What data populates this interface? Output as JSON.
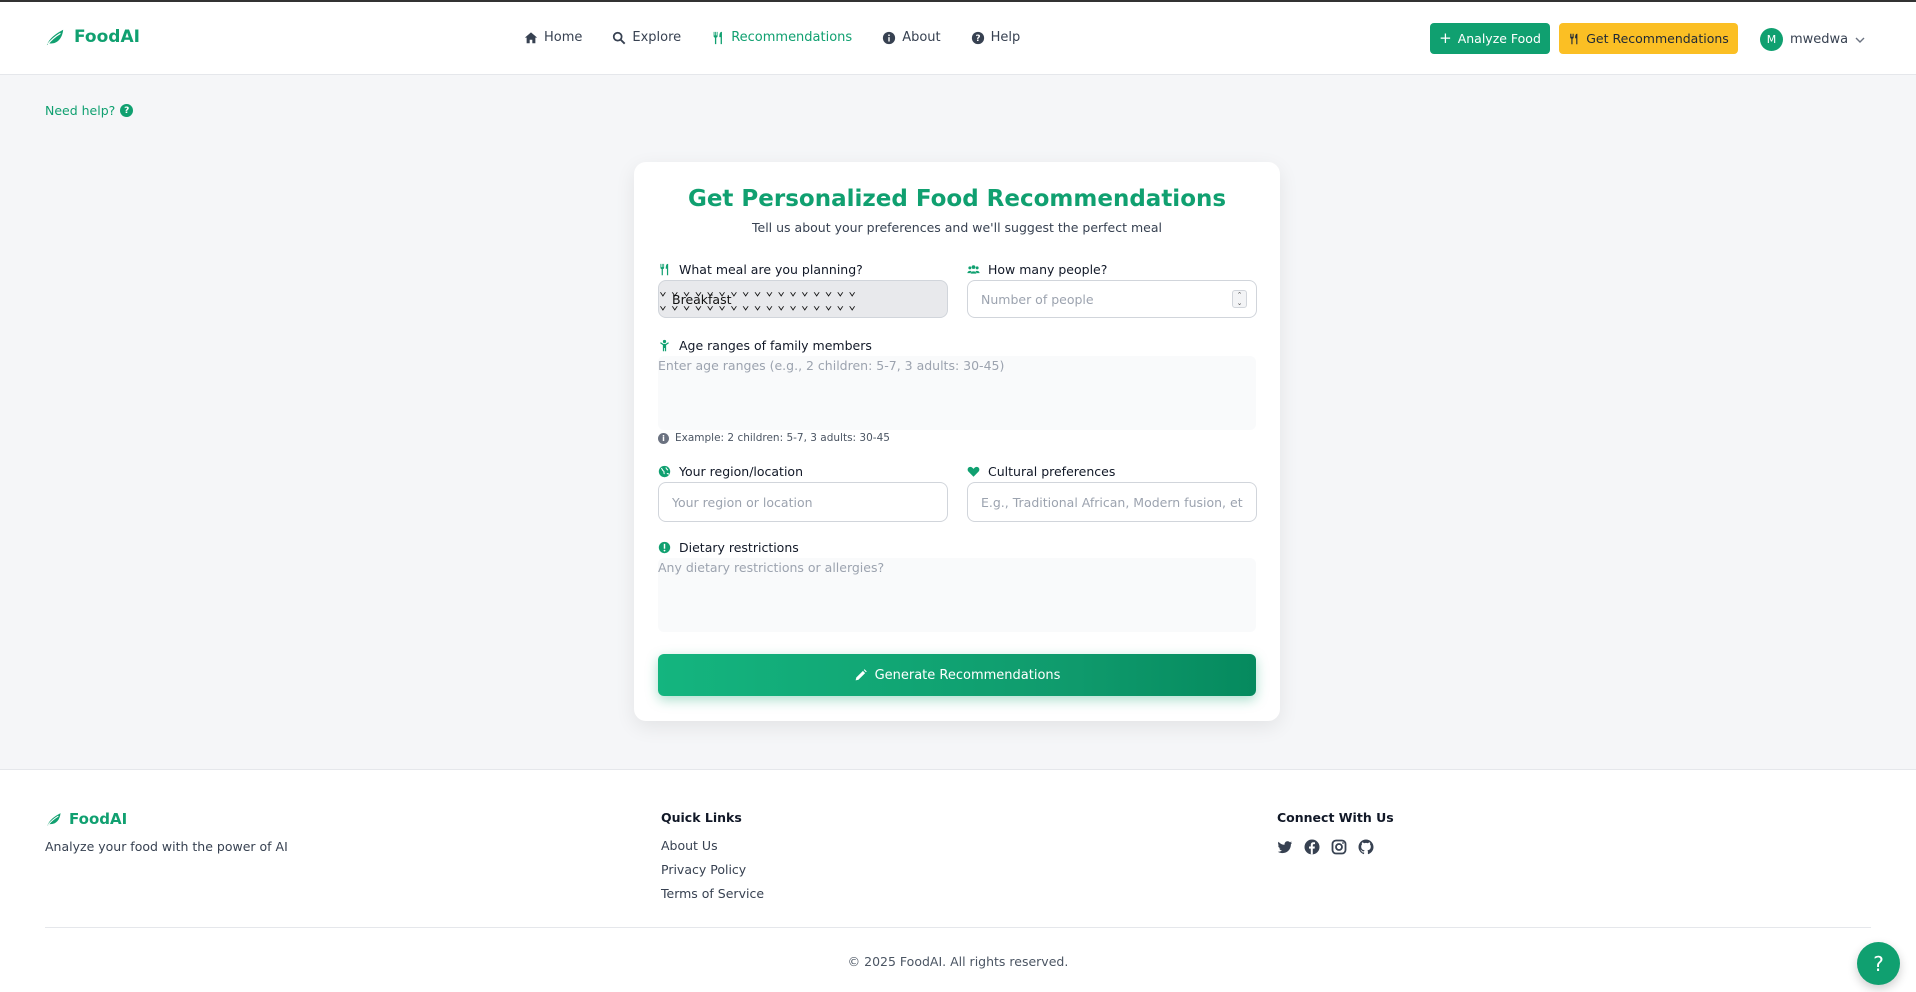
{
  "brand": {
    "name": "FoodAI",
    "color": "#10a070",
    "icon": "leaf-icon"
  },
  "nav": {
    "items": [
      {
        "label": "Home",
        "icon": "home-icon",
        "active": false
      },
      {
        "label": "Explore",
        "icon": "search-icon",
        "active": false
      },
      {
        "label": "Recommendations",
        "icon": "utensils-icon",
        "active": true
      },
      {
        "label": "About",
        "icon": "info-icon",
        "active": false
      },
      {
        "label": "Help",
        "icon": "question-icon",
        "active": false
      }
    ],
    "analyze_label": "Analyze Food",
    "recommend_label": "Get Recommendations",
    "user": {
      "initial": "M",
      "name": "mwedwa"
    }
  },
  "need_help": "Need help?",
  "form": {
    "title": "Get Personalized Food Recommendations",
    "subtitle": "Tell us about your preferences and we'll suggest the perfect meal",
    "meal": {
      "label": "What meal are you planning?",
      "value": "Breakfast"
    },
    "people": {
      "label": "How many people?",
      "placeholder": "Number of people"
    },
    "ages": {
      "label": "Age ranges of family members",
      "placeholder": "Enter age ranges (e.g., 2 children: 5-7, 3 adults: 30-45)",
      "hint": "Example: 2 children: 5-7, 3 adults: 30-45"
    },
    "region": {
      "label": "Your region/location",
      "placeholder": "Your region or location"
    },
    "culture": {
      "label": "Cultural preferences",
      "placeholder": "E.g., Traditional African, Modern fusion, etc."
    },
    "dietary": {
      "label": "Dietary restrictions",
      "placeholder": "Any dietary restrictions or allergies?"
    },
    "submit_label": "Generate Recommendations"
  },
  "footer": {
    "brand": "FoodAI",
    "tagline": "Analyze your food with the power of AI",
    "quick_links_title": "Quick Links",
    "links": [
      "About Us",
      "Privacy Policy",
      "Terms of Service"
    ],
    "connect_title": "Connect With Us",
    "social_icons": [
      "twitter-icon",
      "facebook-icon",
      "instagram-icon",
      "github-icon"
    ],
    "copyright": "© 2025 FoodAI. All rights reserved."
  },
  "help_fab": "?",
  "colors": {
    "primary": "#10a070",
    "accent": "#fbbf24",
    "background": "#f5f6f8"
  }
}
